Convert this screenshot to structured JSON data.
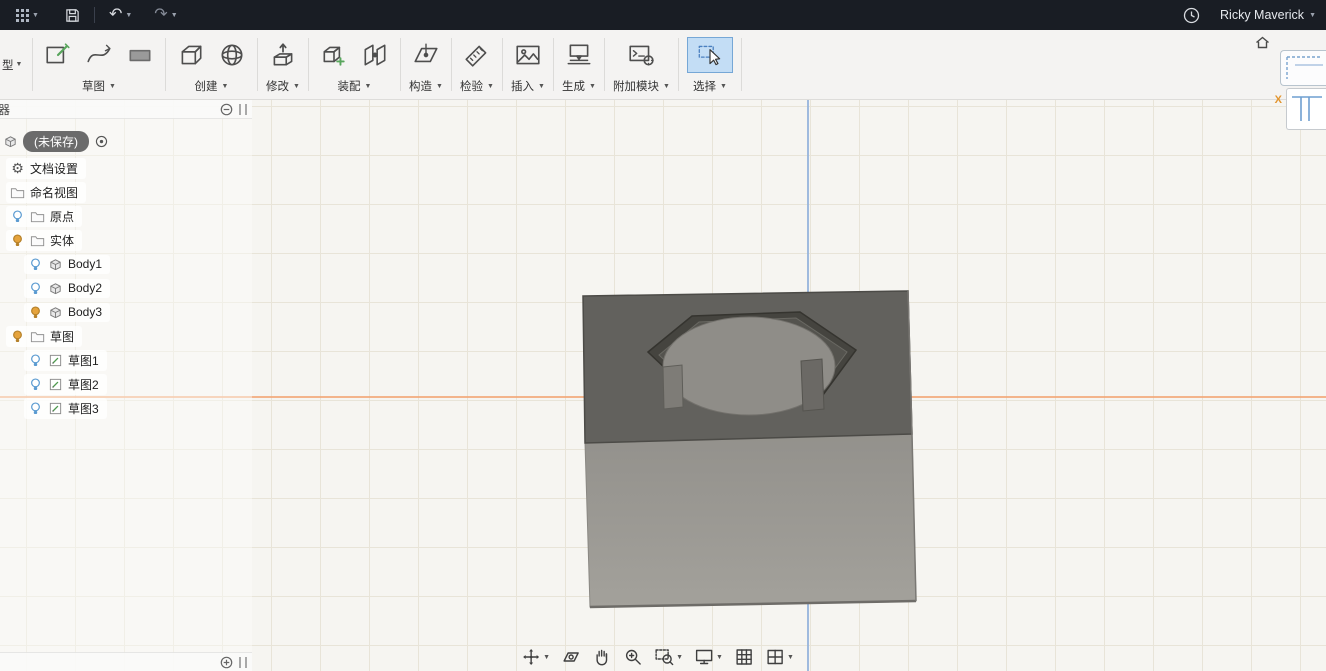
{
  "colors": {
    "topbar_bg": "#191d24",
    "toolbar_bg": "#f4f3f2",
    "viewport_bg": "#f6f5f1",
    "grid_line": "#e8e4d8",
    "select_tool_bg": "#c3ddf5",
    "select_tool_border": "#76a7d6",
    "axis_horizontal": "#f2a879",
    "axis_vertical": "#96b4dc",
    "model_top": "#62615d",
    "model_front": "#9b9994",
    "pocket_wall": "#45443f",
    "pocket_floor": "#54534e",
    "cylinder_top": "#8f8d88",
    "tab_left": "#7e7c77",
    "tab_right": "#6b6965",
    "bulb_on": "#e5a33c",
    "bulb_off": "#5b9bd1",
    "doc_pill_bg": "#6b6b6b"
  },
  "topbar": {
    "user_name": "Ricky Maverick"
  },
  "toolbar": {
    "workspace_partial_label": "型",
    "groups": [
      {
        "label": "草图"
      },
      {
        "label": "创建"
      },
      {
        "label": "修改"
      },
      {
        "label": "装配"
      },
      {
        "label": "构造"
      },
      {
        "label": "检验"
      },
      {
        "label": "插入"
      },
      {
        "label": "生成"
      },
      {
        "label": "附加模块"
      },
      {
        "label": "选择"
      }
    ]
  },
  "browser": {
    "panel_edge_label": "器",
    "document": {
      "label": "(未保存)"
    },
    "rows": [
      {
        "label": "文档设置",
        "icon": "gear",
        "level": 1,
        "bulb": "none"
      },
      {
        "label": "命名视图",
        "icon": "folder",
        "level": 1,
        "bulb": "none"
      },
      {
        "label": "原点",
        "icon": "folder",
        "level": 1,
        "bulb": "off"
      },
      {
        "label": "实体",
        "icon": "folder",
        "level": 1,
        "bulb": "on"
      },
      {
        "label": "Body1",
        "icon": "body",
        "level": 2,
        "bulb": "off"
      },
      {
        "label": "Body2",
        "icon": "body",
        "level": 2,
        "bulb": "off"
      },
      {
        "label": "Body3",
        "icon": "body",
        "level": 2,
        "bulb": "on"
      },
      {
        "label": "草图",
        "icon": "folder",
        "level": 1,
        "bulb": "on"
      },
      {
        "label": "草图1",
        "icon": "sketch",
        "level": 2,
        "bulb": "off"
      },
      {
        "label": "草图2",
        "icon": "sketch",
        "level": 2,
        "bulb": "off"
      },
      {
        "label": "草图3",
        "icon": "sketch",
        "level": 2,
        "bulb": "off"
      }
    ]
  },
  "viewport": {
    "viewcube_axis_label": "X",
    "navbar_icons": [
      "orbit",
      "look-at",
      "pan",
      "zoom",
      "zoom-window",
      "display-settings",
      "grid-and-snaps",
      "viewports"
    ]
  }
}
